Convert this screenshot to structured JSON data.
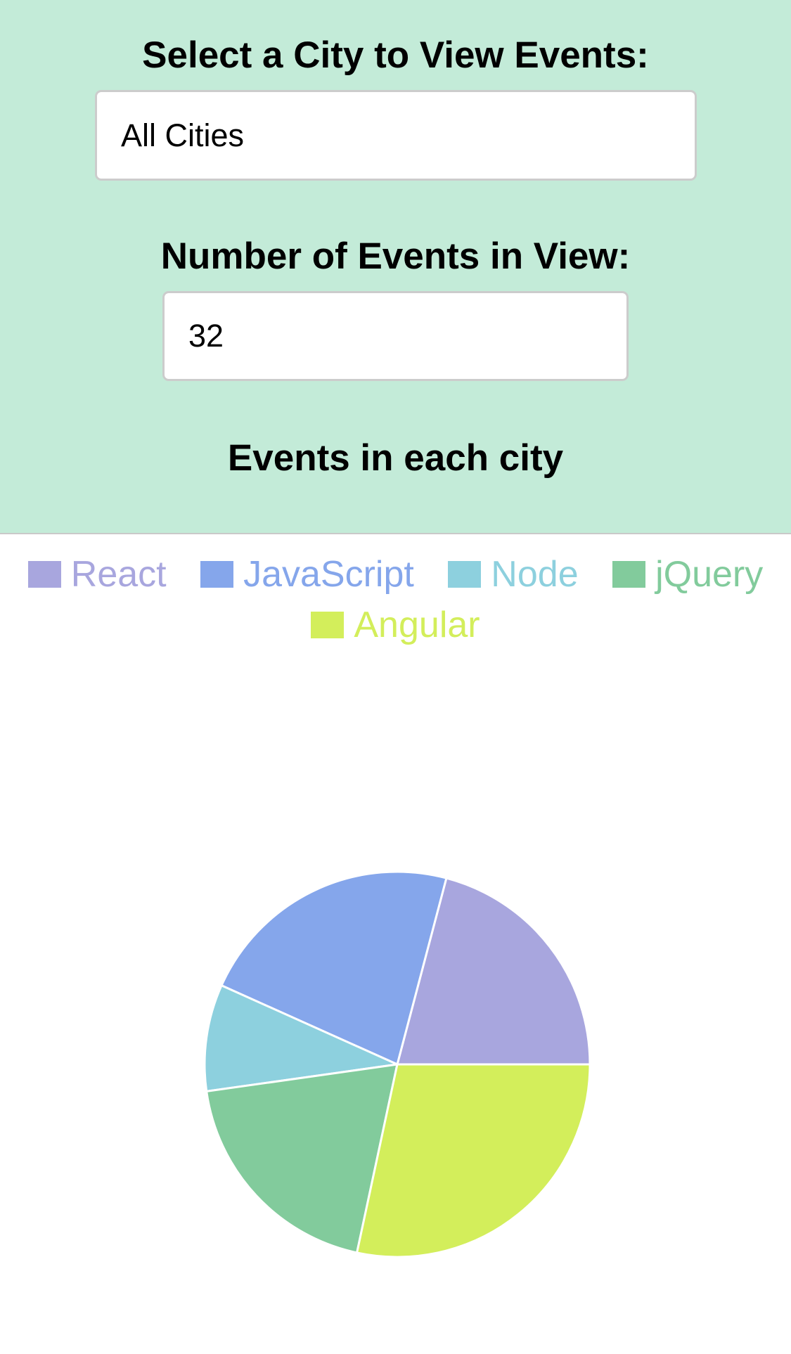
{
  "header": {
    "select_label": "Select a City to View Events:",
    "number_label": "Number of Events in View:",
    "chart_title": "Events in each city"
  },
  "city_select": {
    "value": "All Cities"
  },
  "events_count": {
    "value": "32"
  },
  "chart_data": {
    "type": "pie",
    "labels": [
      "React",
      "JavaScript",
      "Node",
      "jQuery",
      "Angular"
    ],
    "values": [
      7,
      7.5,
      3,
      6.5,
      9.5
    ],
    "colors": [
      "#a8a6de",
      "#85a6eb",
      "#8dd0de",
      "#82cb9c",
      "#d3ee5b"
    ],
    "start_angle_deg": 0,
    "direction": "counterclockwise",
    "legend_position": "top"
  }
}
